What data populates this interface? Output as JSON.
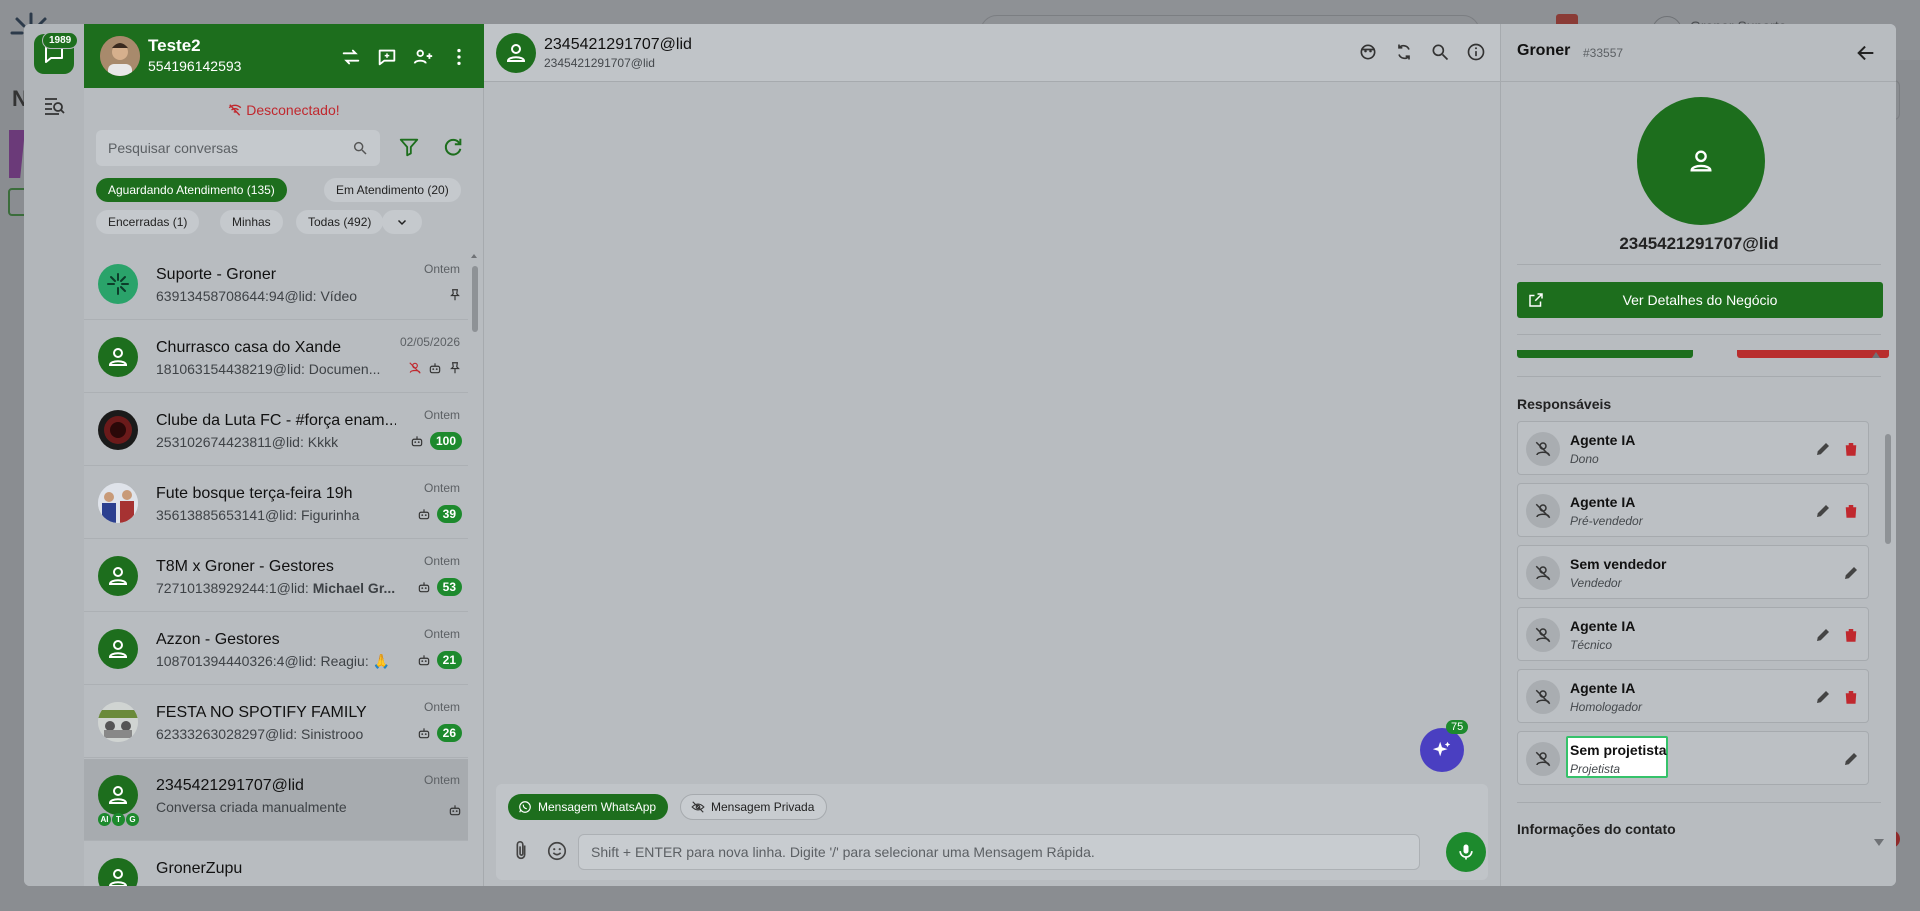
{
  "background": {
    "user_name": "Groner Suporte",
    "left_letter": "N"
  },
  "rail": {
    "chat_badge": "1989"
  },
  "conv_panel": {
    "account_name": "Teste2",
    "account_phone": "554196142593",
    "status": "Desconectado!",
    "search_placeholder": "Pesquisar conversas",
    "chips": [
      {
        "label": "Aguardando Atendimento (135)",
        "active": true
      },
      {
        "label": "Em Atendimento (20)",
        "active": false
      },
      {
        "label": "Encerradas (1)",
        "active": false
      },
      {
        "label": "Minhas",
        "active": false
      },
      {
        "label": "Todas (492)",
        "active": false
      }
    ],
    "conversations": [
      {
        "name": "Suporte - Groner",
        "preview": "63913458708644:94@lid: Vídeo",
        "time": "Ontem",
        "count": "",
        "pinned": true
      },
      {
        "name": "Churrasco casa do Xande",
        "preview": "181063154438219@lid: Documen...",
        "time": "02/05/2026",
        "count": "",
        "pinned": true
      },
      {
        "name": "Clube da Luta FC - #força enam...",
        "preview": "253102674423811@lid: Kkkk",
        "time": "Ontem",
        "count": "100"
      },
      {
        "name": "Fute bosque terça-feira 19h",
        "preview": "35613885653141@lid: Figurinha",
        "time": "Ontem",
        "count": "39"
      },
      {
        "name": "T8M x Groner - Gestores",
        "preview": "72710138929244:1@lid:",
        "preview_bold": "Michael Gr...",
        "time": "Ontem",
        "count": "53"
      },
      {
        "name": "Azzon - Gestores",
        "preview": "108701394440326:4@lid: Reagiu: 🙏",
        "time": "Ontem",
        "count": "21"
      },
      {
        "name": "FESTA NO SPOTIFY FAMILY",
        "preview": "62333263028297@lid: Sinistrooo",
        "time": "Ontem",
        "count": "26"
      },
      {
        "name": "2345421291707@lid",
        "preview": "Conversa criada manualmente",
        "time": "Ontem",
        "count": "",
        "tags": [
          "AI",
          "T",
          "G"
        ]
      },
      {
        "name": "GronerZupu",
        "preview": "",
        "time": "",
        "count": ""
      }
    ]
  },
  "chat": {
    "contact_name": "2345421291707@lid",
    "contact_sub": "2345421291707@lid",
    "ai_badge": "75",
    "tab_whatsapp": "Mensagem WhatsApp",
    "tab_private": "Mensagem Privada",
    "input_placeholder": "Shift + ENTER para nova linha. Digite '/' para selecionar uma Mensagem Rápida."
  },
  "details": {
    "title": "Groner",
    "id": "#33557",
    "contact_name": "2345421291707@lid",
    "deal_button": "Ver Detalhes do Negócio",
    "responsaveis_title": "Responsáveis",
    "responsaveis": [
      {
        "name": "Agente IA",
        "role": "Dono",
        "deletable": true
      },
      {
        "name": "Agente IA",
        "role": "Pré-vendedor",
        "deletable": true
      },
      {
        "name": "Sem vendedor",
        "role": "Vendedor",
        "deletable": false
      },
      {
        "name": "Agente IA",
        "role": "Técnico",
        "deletable": true
      },
      {
        "name": "Agente IA",
        "role": "Homologador",
        "deletable": true
      },
      {
        "name": "Sem projetista",
        "role": "Projetista",
        "deletable": false,
        "highlighted": true
      }
    ],
    "info_title": "Informações do contato"
  },
  "colors": {
    "brand_green": "#1d6e1d",
    "count_green": "#1d8a2d",
    "danger_red": "#c0282e",
    "ai_purple": "#4a3fc1"
  }
}
